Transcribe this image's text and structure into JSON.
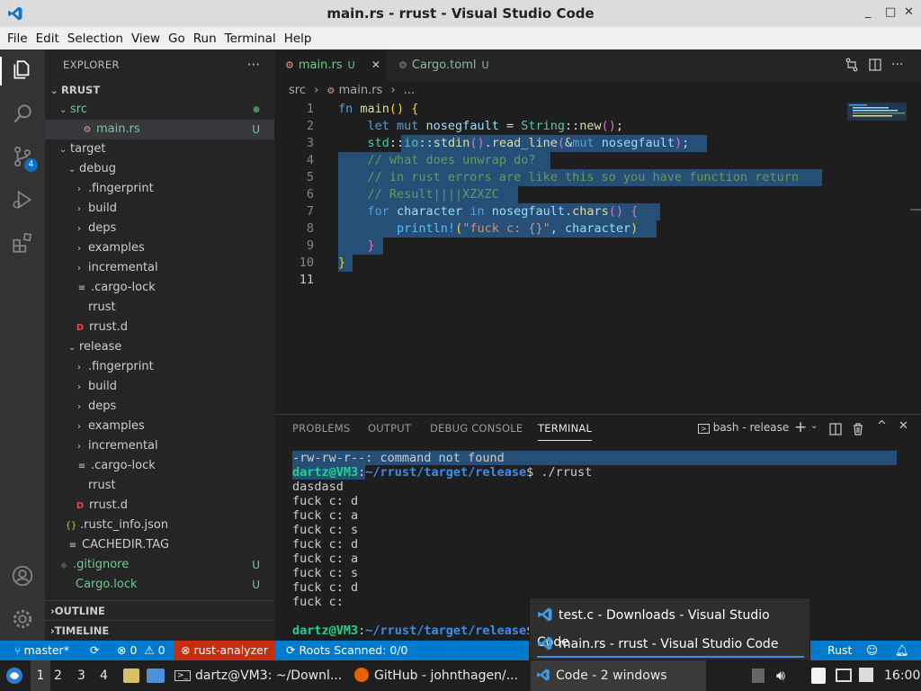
{
  "window": {
    "title": "main.rs - rrust - Visual Studio Code",
    "min": "_",
    "max": "□",
    "close": "✕"
  },
  "menu": [
    "File",
    "Edit",
    "Selection",
    "View",
    "Go",
    "Run",
    "Terminal",
    "Help"
  ],
  "activity": {
    "scm_badge": "4"
  },
  "explorer": {
    "header": "EXPLORER",
    "more": "···",
    "root": "RRUST",
    "items": [
      {
        "label": "src",
        "status": "●"
      },
      {
        "label": "main.rs",
        "status": "U"
      },
      {
        "label": "target",
        "status": ""
      },
      {
        "label": "debug",
        "status": ""
      },
      {
        "label": ".fingerprint",
        "status": ""
      },
      {
        "label": "build",
        "status": ""
      },
      {
        "label": "deps",
        "status": ""
      },
      {
        "label": "examples",
        "status": ""
      },
      {
        "label": "incremental",
        "status": ""
      },
      {
        "label": ".cargo-lock",
        "status": ""
      },
      {
        "label": "rrust",
        "status": ""
      },
      {
        "label": "rrust.d",
        "status": ""
      },
      {
        "label": "release",
        "status": ""
      },
      {
        "label": ".fingerprint",
        "status": ""
      },
      {
        "label": "build",
        "status": ""
      },
      {
        "label": "deps",
        "status": ""
      },
      {
        "label": "examples",
        "status": ""
      },
      {
        "label": "incremental",
        "status": ""
      },
      {
        "label": ".cargo-lock",
        "status": ""
      },
      {
        "label": "rrust",
        "status": ""
      },
      {
        "label": "rrust.d",
        "status": ""
      },
      {
        "label": ".rustc_info.json",
        "status": ""
      },
      {
        "label": "CACHEDIR.TAG",
        "status": ""
      },
      {
        "label": ".gitignore",
        "status": "U"
      },
      {
        "label": "Cargo.lock",
        "status": "U"
      }
    ],
    "outline": "OUTLINE",
    "timeline": "TIMELINE"
  },
  "tabs": [
    {
      "label": "main.rs",
      "status": "U",
      "close": "✕"
    },
    {
      "label": "Cargo.toml",
      "status": "U"
    }
  ],
  "breadcrumb": {
    "folder": "src",
    "file": "main.rs",
    "more": "..."
  },
  "editor": {
    "line_numbers": [
      "1",
      "2",
      "3",
      "4",
      "5",
      "6",
      "7",
      "8",
      "9",
      "10",
      "11"
    ],
    "lines": [
      {
        "parts": [
          [
            "kw",
            "fn "
          ],
          [
            "fn",
            "main"
          ],
          [
            "br1",
            "() {"
          ]
        ]
      },
      {
        "parts": [
          [
            "",
            "    "
          ],
          [
            "kw",
            "let mut "
          ],
          [
            "var",
            "nosegfault"
          ],
          [
            "",
            " = "
          ],
          [
            "ty",
            "String"
          ],
          [
            "",
            "::"
          ],
          [
            "fn",
            "new"
          ],
          [
            "br2",
            "()"
          ],
          [
            "",
            ";"
          ]
        ]
      },
      {
        "parts": [
          [
            "",
            "    "
          ],
          [
            "ty",
            "std"
          ],
          [
            "",
            "::"
          ],
          [
            "ty",
            "io"
          ],
          [
            "",
            "::"
          ],
          [
            "fn",
            "stdin"
          ],
          [
            "br2",
            "()"
          ],
          [
            "",
            "."
          ],
          [
            "fn",
            "read_line"
          ],
          [
            "br2",
            "("
          ],
          [
            "",
            "&"
          ],
          [
            "kw",
            "mut "
          ],
          [
            "var",
            "nosegfault"
          ],
          [
            "br2",
            ")"
          ],
          [
            "",
            ";"
          ]
        ]
      },
      {
        "parts": [
          [
            "",
            "    "
          ],
          [
            "cm",
            "// what does unwrap do?"
          ]
        ]
      },
      {
        "parts": [
          [
            "",
            "    "
          ],
          [
            "cm",
            "// in rust errors are like this so you have function return"
          ]
        ]
      },
      {
        "parts": [
          [
            "",
            "    "
          ],
          [
            "cm",
            "// Result||||XZXZC"
          ]
        ]
      },
      {
        "parts": [
          [
            "",
            "    "
          ],
          [
            "kw",
            "for "
          ],
          [
            "var",
            "character "
          ],
          [
            "kw",
            "in "
          ],
          [
            "var",
            "nosegfault"
          ],
          [
            "",
            "."
          ],
          [
            "fn",
            "chars"
          ],
          [
            "br2",
            "() {"
          ]
        ]
      },
      {
        "parts": [
          [
            "",
            "        "
          ],
          [
            "mac",
            "println!"
          ],
          [
            "br1",
            "("
          ],
          [
            "str",
            "\"fuck c: {}\""
          ],
          [
            "",
            ", "
          ],
          [
            "var",
            "character"
          ],
          [
            "br1",
            ")"
          ]
        ]
      },
      {
        "parts": [
          [
            "",
            "    "
          ],
          [
            "br2",
            "}"
          ]
        ]
      },
      {
        "parts": [
          [
            "br1",
            "}"
          ]
        ]
      },
      {
        "parts": []
      }
    ]
  },
  "panel": {
    "tabs": [
      "PROBLEMS",
      "OUTPUT",
      "DEBUG CONSOLE",
      "TERMINAL"
    ],
    "shell": "bash - release",
    "terminal": [
      {
        "text": "-rw-rw-r--: command not found"
      },
      {
        "user": "dartz@VM3",
        "path": "~/rrust/target/release",
        "cmd": "$ ./rrust"
      },
      {
        "text": "dasdasd"
      },
      {
        "text": "fuck c: d"
      },
      {
        "text": "fuck c: a"
      },
      {
        "text": "fuck c: s"
      },
      {
        "text": "fuck c: d"
      },
      {
        "text": "fuck c: a"
      },
      {
        "text": "fuck c: s"
      },
      {
        "text": "fuck c: d"
      },
      {
        "text": "fuck c:"
      },
      {
        "text": ""
      },
      {
        "user": "dartz@VM3",
        "path": "~/rrust/target/release",
        "cmd": "$"
      }
    ]
  },
  "statusbar": {
    "branch": "master*",
    "errors": "0",
    "warnings": "0",
    "analyzer": "rust-analyzer",
    "roots": "Roots Scanned: 0/0",
    "language": "Rust"
  },
  "popup": [
    {
      "label": "test.c - Downloads - Visual Studio Code"
    },
    {
      "label": "main.rs - rrust - Visual Studio Code"
    }
  ],
  "taskbar": {
    "workspaces": [
      "1",
      "2",
      "3",
      "4"
    ],
    "terminal": "dartz@VM3: ~/Downl...",
    "firefox": "GitHub - johnthagen/...",
    "code": "Code - 2 windows",
    "clock": "16:00"
  }
}
